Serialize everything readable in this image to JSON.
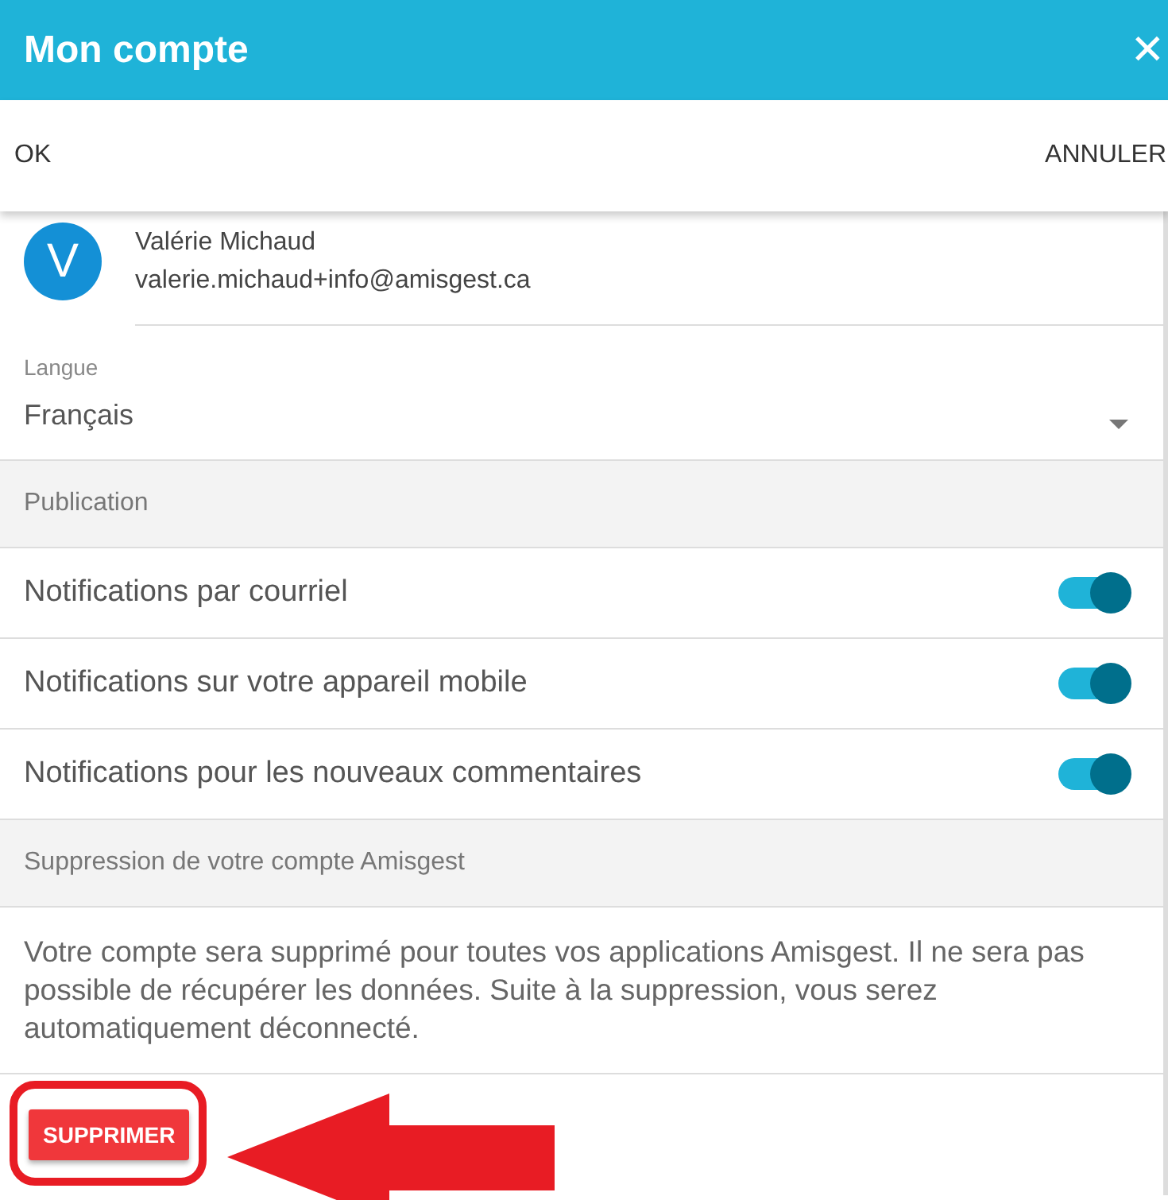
{
  "header": {
    "title": "Mon compte",
    "close": "✕"
  },
  "actions": {
    "ok": "OK",
    "cancel": "ANNULER"
  },
  "user": {
    "initial": "V",
    "name": "Valérie Michaud",
    "email": "valerie.michaud+info@amisgest.ca"
  },
  "language": {
    "label": "Langue",
    "value": "Français"
  },
  "sections": [
    {
      "title": "Publication",
      "settings": [
        {
          "label": "Notifications par courriel",
          "on": true
        },
        {
          "label": "Notifications sur votre appareil mobile",
          "on": true
        },
        {
          "label": "Notifications pour les nouveaux commentaires",
          "on": true
        }
      ]
    },
    {
      "title": "Suppression de votre compte Amisgest",
      "text": "Votre compte sera supprimé pour toutes vos applications Amisgest. Il ne sera pas possible de récupérer les données. Suite à la suppression, vous serez automatiquement déconnecté.",
      "button": "SUPPRIMER"
    }
  ]
}
